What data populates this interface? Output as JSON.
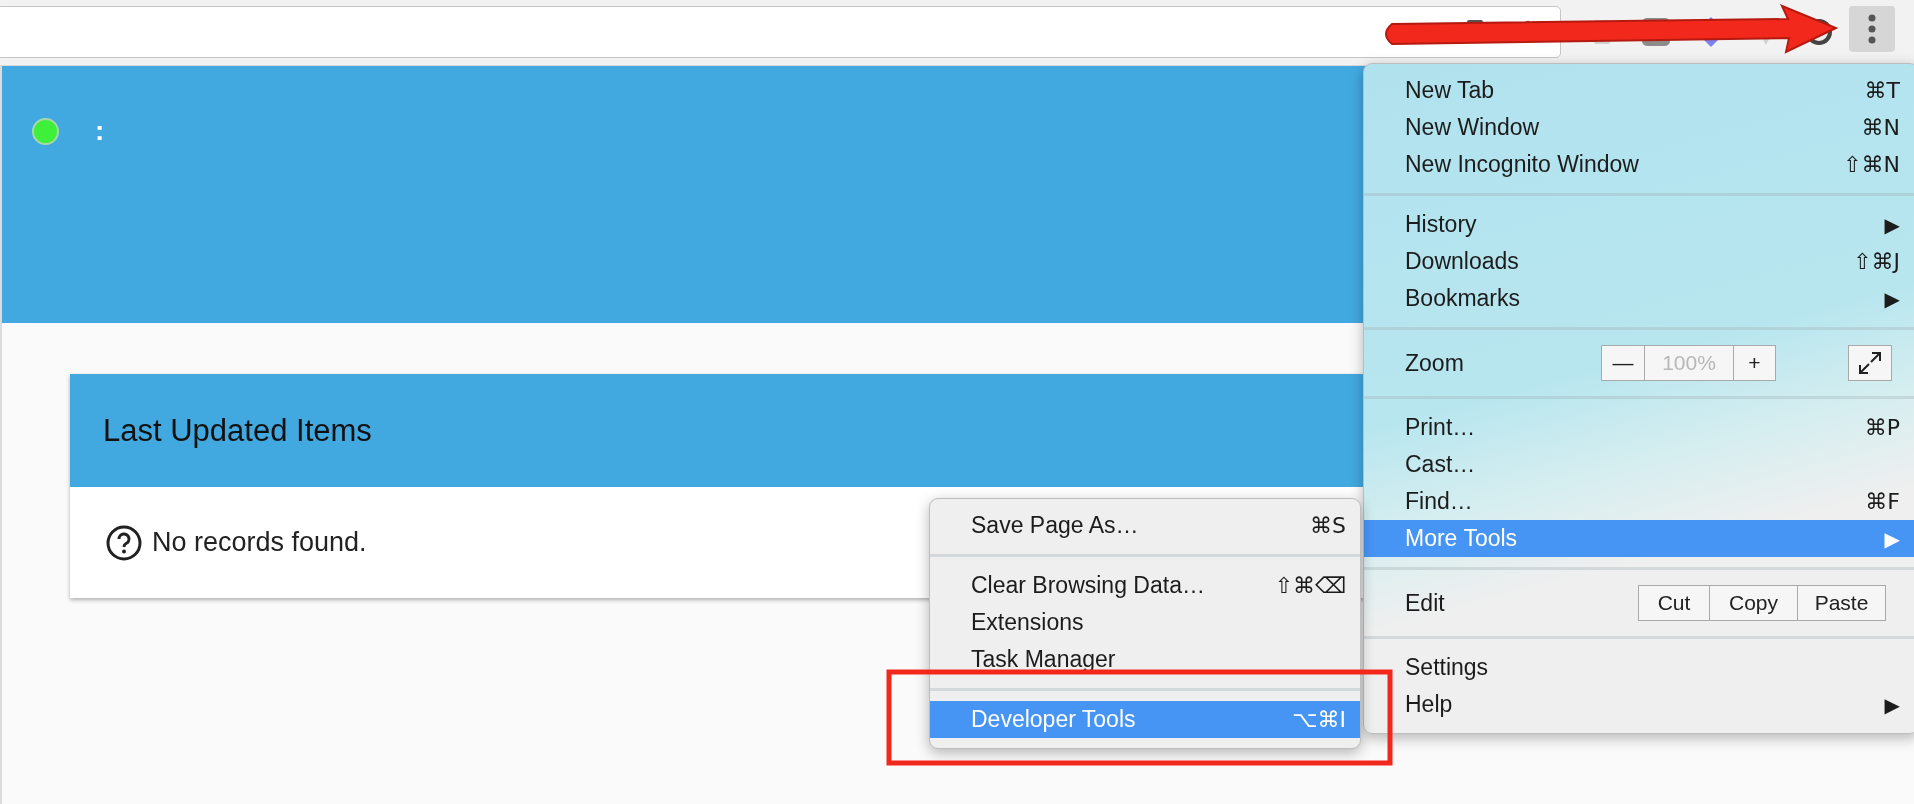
{
  "header": {
    "text": ":"
  },
  "card": {
    "title": "Last Updated Items",
    "message": "No records found."
  },
  "menu": {
    "sections": [
      [
        {
          "kind": "command",
          "label": "New Tab",
          "shortcut": "⌘T",
          "highlighted": false
        },
        {
          "kind": "command",
          "label": "New Window",
          "shortcut": "⌘N",
          "highlighted": false
        },
        {
          "kind": "command",
          "label": "New Incognito Window",
          "shortcut": "⇧⌘N",
          "highlighted": false
        }
      ],
      [
        {
          "kind": "submenu",
          "label": "History",
          "arrow": "▶",
          "highlighted": false
        },
        {
          "kind": "command",
          "label": "Downloads",
          "shortcut": "⇧⌘J",
          "highlighted": false
        },
        {
          "kind": "submenu",
          "label": "Bookmarks",
          "arrow": "▶",
          "highlighted": false
        }
      ],
      [
        {
          "kind": "zoom",
          "label": "Zoom",
          "minus": "—",
          "value": "100%",
          "plus": "+",
          "highlighted": false
        }
      ],
      [
        {
          "kind": "command",
          "label": "Print…",
          "shortcut": "⌘P",
          "highlighted": false
        },
        {
          "kind": "command",
          "label": "Cast…",
          "highlighted": false
        },
        {
          "kind": "command",
          "label": "Find…",
          "shortcut": "⌘F",
          "highlighted": false
        },
        {
          "kind": "submenu",
          "label": "More Tools",
          "arrow": "▶",
          "highlighted": true
        }
      ],
      [
        {
          "kind": "edit",
          "label": "Edit",
          "buttons": [
            "Cut",
            "Copy",
            "Paste"
          ],
          "highlighted": false
        }
      ],
      [
        {
          "kind": "command",
          "label": "Settings",
          "highlighted": false
        },
        {
          "kind": "submenu",
          "label": "Help",
          "arrow": "▶",
          "highlighted": false
        }
      ]
    ]
  },
  "submenu": {
    "sections": [
      [
        {
          "kind": "command",
          "label": "Save Page As…",
          "shortcut": "⌘S",
          "highlighted": false
        }
      ],
      [
        {
          "kind": "command",
          "label": "Clear Browsing Data…",
          "shortcut": "⇧⌘⌫",
          "highlighted": false
        },
        {
          "kind": "command",
          "label": "Extensions",
          "highlighted": false
        },
        {
          "kind": "command",
          "label": "Task Manager",
          "highlighted": false
        }
      ],
      [
        {
          "kind": "command",
          "label": "Developer Tools",
          "shortcut": "⌥⌘I",
          "highlighted": true
        }
      ]
    ]
  }
}
